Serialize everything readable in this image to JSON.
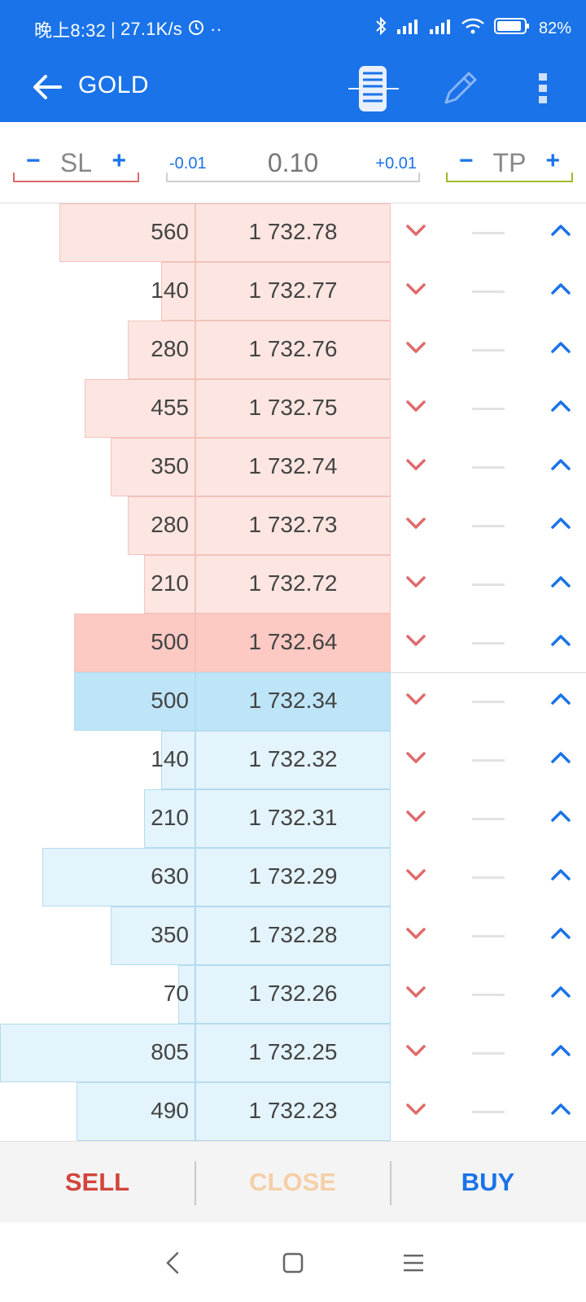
{
  "status_bar": {
    "time": "晚上8:32",
    "speed": "27.1K/s",
    "battery": "82%",
    "icons": [
      "alarm-icon",
      "bluetooth-icon",
      "signal-hd-icon",
      "signal-hd-icon",
      "wifi-icon",
      "battery-icon"
    ]
  },
  "app_bar": {
    "title": "GOLD",
    "icons": [
      "back-arrow-icon",
      "depth-of-market-icon",
      "pencil-icon",
      "more-vert-icon"
    ]
  },
  "controls": {
    "sl_label": "SL",
    "tp_label": "TP",
    "minus": "−",
    "plus": "+",
    "volume": "0.10",
    "vol_minus": "-0.01",
    "vol_plus": "+0.01"
  },
  "colors": {
    "primary": "#1a73e8",
    "ask_fill": "#fde6e1",
    "bid_fill": "#e3f4fc",
    "sell": "#d1453b",
    "sl_line": "#d96a6a",
    "tp_line": "#9dbb2c"
  },
  "book": {
    "asks": [
      {
        "volume": "560",
        "price": "1 732.78"
      },
      {
        "volume": "140",
        "price": "1 732.77"
      },
      {
        "volume": "280",
        "price": "1 732.76"
      },
      {
        "volume": "455",
        "price": "1 732.75"
      },
      {
        "volume": "350",
        "price": "1 732.74"
      },
      {
        "volume": "280",
        "price": "1 732.73"
      },
      {
        "volume": "210",
        "price": "1 732.72"
      },
      {
        "volume": "500",
        "price": "1 732.64"
      }
    ],
    "bids": [
      {
        "volume": "500",
        "price": "1 732.34"
      },
      {
        "volume": "140",
        "price": "1 732.32"
      },
      {
        "volume": "210",
        "price": "1 732.31"
      },
      {
        "volume": "630",
        "price": "1 732.29"
      },
      {
        "volume": "350",
        "price": "1 732.28"
      },
      {
        "volume": "70",
        "price": "1 732.26"
      },
      {
        "volume": "805",
        "price": "1 732.25"
      },
      {
        "volume": "490",
        "price": "1 732.23"
      }
    ]
  },
  "actions": {
    "sell": "SELL",
    "close": "CLOSE",
    "buy": "BUY"
  },
  "nav": {
    "icons": [
      "nav-back-icon",
      "nav-home-icon",
      "nav-menu-icon"
    ]
  }
}
